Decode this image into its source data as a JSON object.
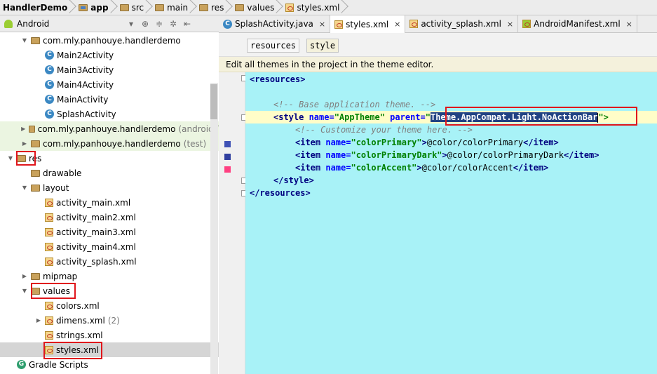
{
  "breadcrumb": [
    "HandlerDemo",
    "app",
    "src",
    "main",
    "res",
    "values",
    "styles.xml"
  ],
  "toolbar": {
    "view_label": "Android",
    "icons": [
      "globe-icon",
      "sort-icon",
      "settings-icon",
      "collapse-icon"
    ]
  },
  "tree": [
    {
      "label": "com.mly.panhouye.handlerdemo",
      "suffix": "",
      "icon": "package",
      "indent": 1,
      "expanded": true,
      "style": ""
    },
    {
      "label": "Main2Activity",
      "suffix": "",
      "icon": "class",
      "indent": 2,
      "style": ""
    },
    {
      "label": "Main3Activity",
      "suffix": "",
      "icon": "class",
      "indent": 2,
      "style": ""
    },
    {
      "label": "Main4Activity",
      "suffix": "",
      "icon": "class",
      "indent": 2,
      "style": ""
    },
    {
      "label": "MainActivity",
      "suffix": "",
      "icon": "class",
      "indent": 2,
      "style": ""
    },
    {
      "label": "SplashActivity",
      "suffix": "",
      "icon": "class",
      "indent": 2,
      "style": ""
    },
    {
      "label": "com.mly.panhouye.handlerdemo",
      "suffix": "(androidT",
      "icon": "package",
      "indent": 1,
      "expanded": false,
      "style": "green"
    },
    {
      "label": "com.mly.panhouye.handlerdemo",
      "suffix": "(test)",
      "icon": "package",
      "indent": 1,
      "expanded": false,
      "style": "green"
    },
    {
      "label": "res",
      "suffix": "",
      "icon": "resfolder",
      "indent": 0,
      "expanded": true,
      "style": ""
    },
    {
      "label": "drawable",
      "suffix": "",
      "icon": "folder",
      "indent": 1,
      "style": ""
    },
    {
      "label": "layout",
      "suffix": "",
      "icon": "folder",
      "indent": 1,
      "expanded": true,
      "style": ""
    },
    {
      "label": "activity_main.xml",
      "suffix": "",
      "icon": "xml",
      "indent": 2,
      "style": ""
    },
    {
      "label": "activity_main2.xml",
      "suffix": "",
      "icon": "xml",
      "indent": 2,
      "style": ""
    },
    {
      "label": "activity_main3.xml",
      "suffix": "",
      "icon": "xml",
      "indent": 2,
      "style": ""
    },
    {
      "label": "activity_main4.xml",
      "suffix": "",
      "icon": "xml",
      "indent": 2,
      "style": ""
    },
    {
      "label": "activity_splash.xml",
      "suffix": "",
      "icon": "xml",
      "indent": 2,
      "style": ""
    },
    {
      "label": "mipmap",
      "suffix": "",
      "icon": "folder",
      "indent": 1,
      "expanded": false,
      "style": ""
    },
    {
      "label": "values",
      "suffix": "",
      "icon": "folder",
      "indent": 1,
      "expanded": true,
      "style": ""
    },
    {
      "label": "colors.xml",
      "suffix": "",
      "icon": "xml",
      "indent": 2,
      "style": ""
    },
    {
      "label": "dimens.xml",
      "suffix": "(2)",
      "icon": "xml",
      "indent": 2,
      "expanded": false,
      "style": ""
    },
    {
      "label": "strings.xml",
      "suffix": "",
      "icon": "xml",
      "indent": 2,
      "style": ""
    },
    {
      "label": "styles.xml",
      "suffix": "",
      "icon": "xml",
      "indent": 2,
      "style": "sel"
    },
    {
      "label": "Gradle Scripts",
      "suffix": "",
      "icon": "gradle",
      "indent": 0,
      "style": ""
    }
  ],
  "tabs": [
    {
      "label": "SplashActivity.java",
      "icon": "java"
    },
    {
      "label": "styles.xml",
      "icon": "xml",
      "active": true
    },
    {
      "label": "activity_splash.xml",
      "icon": "xml"
    },
    {
      "label": "AndroidManifest.xml",
      "icon": "manifest"
    }
  ],
  "editor_crumbs": [
    "resources",
    "style"
  ],
  "banner": "Edit all themes in the project in the theme editor.",
  "code": {
    "l1": "<resources>",
    "l3": "<!-- Base application theme. -->",
    "l4_open": "<style ",
    "l4_name_attr": "name=",
    "l4_name_val": "\"AppTheme\"",
    "l4_parent_attr": " parent=",
    "l4_q": "\"",
    "l4_parent_val": "Theme.AppCompat.Light.NoActionBar",
    "l4_close": "\">",
    "l5": "<!-- Customize your theme here. -->",
    "items": [
      {
        "name": "\"colorPrimary\"",
        "value": "@color/colorPrimary"
      },
      {
        "name": "\"colorPrimaryDark\"",
        "value": "@color/colorPrimaryDark"
      },
      {
        "name": "\"colorAccent\"",
        "value": "@color/colorAccent"
      }
    ],
    "l9": "</style>",
    "l10": "</resources>"
  },
  "gutter_colors": [
    "#3f51b5",
    "#303f9f",
    "#ff4081"
  ]
}
